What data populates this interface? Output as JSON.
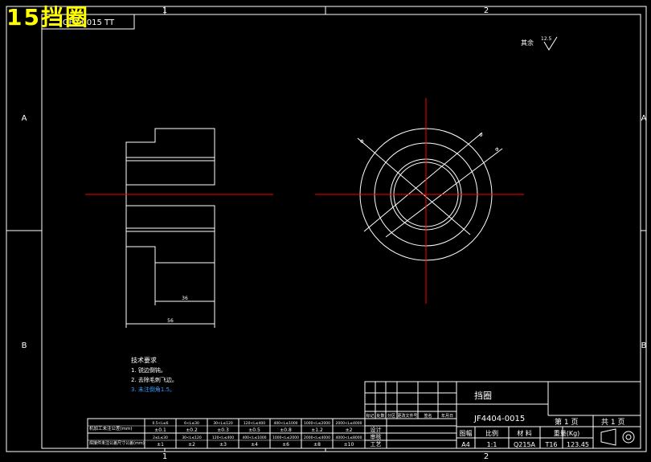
{
  "overlay_title": "15挡圈",
  "top_left_box_text": "GF0-0015  TT",
  "zone_markers": {
    "columns": [
      "1",
      "2"
    ],
    "rows": [
      "A",
      "B"
    ]
  },
  "surface_finish": {
    "label": "其余",
    "value": "12.5"
  },
  "technical_requirements": {
    "heading": "技术要求",
    "items": [
      "1. 锐边倒钝。",
      "2. 去除毛刺飞边。",
      "3. 未注倒角1.5。"
    ]
  },
  "title_block": {
    "part_name": "挡圈",
    "drawing_number": "JF4404-0015",
    "sheet_label": "第 1 页",
    "total_label": "共 1 页",
    "revision_headers": [
      "标记",
      "处数",
      "分区",
      "更改文件号",
      "签名",
      "年月日"
    ],
    "role_labels": [
      "设计",
      "审核",
      "工艺"
    ],
    "bottom_headers": [
      "图幅",
      "比例",
      "材  料",
      "重量(Kg)"
    ],
    "bottom_values": [
      "A4",
      "1:1",
      "Q215A",
      "T16",
      "123.45"
    ]
  },
  "tolerance_table": {
    "row1_label": "机加工未注公差(mm)",
    "row1_ranges": [
      "0.5<L≤6",
      "6<L≤30",
      "30<L≤120",
      "120<L≤400",
      "400<L≤1000",
      "1000<L≤2000",
      "2000<L≤4000"
    ],
    "row1_values": [
      "±0.1",
      "±0.2",
      "±0.3",
      "±0.5",
      "±0.8",
      "±1.2",
      "±2"
    ],
    "row2_label": "焊接件未注公差尺寸公差(mm)",
    "row2_ranges": [
      "2≤L≤30",
      "30<L≤120",
      "120<L≤400",
      "400<L≤1000",
      "1000<L≤2000",
      "2000<L≤4000",
      "4000<L≤8000"
    ],
    "row2_values": [
      "±1",
      "±2",
      "±3",
      "±4",
      "±6",
      "±8",
      "±10"
    ]
  },
  "dimension_labels": {
    "side_inner_width": "36",
    "side_total_width": "56",
    "circle_outer": "Φ",
    "circle_mid": "Φ",
    "circle_inner": "Φ"
  },
  "colors": {
    "outline": "#ffffff",
    "centerline": "#ff0000",
    "title_overlay": "#ffff00",
    "highlight_text": "#3399ff"
  }
}
